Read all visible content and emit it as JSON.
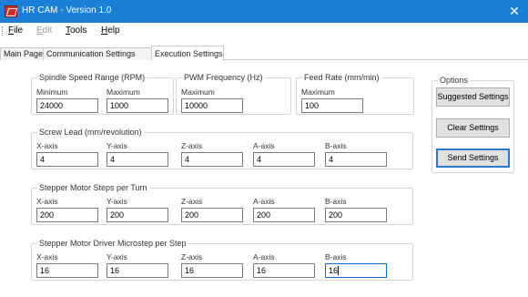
{
  "window": {
    "title": "HR CAM - Version 1.0",
    "close_glyph": "✕"
  },
  "menu": {
    "file": {
      "u": "F",
      "rest": "ile"
    },
    "edit": {
      "u": "E",
      "rest": "dit"
    },
    "tools": {
      "u": "T",
      "rest": "ools"
    },
    "help": {
      "u": "H",
      "rest": "elp"
    }
  },
  "tabs": [
    {
      "label": "Main Page"
    },
    {
      "label": "Communication Settings"
    },
    {
      "label": "Execution Settings"
    }
  ],
  "spindle": {
    "title": "Spindle Speed Range (RPM)",
    "min_label": "Minimum",
    "min_value": "24000",
    "max_label": "Maximum",
    "max_value": "1000"
  },
  "pwm": {
    "title": "PWM Frequency (Hz)",
    "max_label": "Maximum",
    "max_value": "10000"
  },
  "feed": {
    "title": "Feed Rate (mm/min)",
    "max_label": "Maximum",
    "max_value": "100"
  },
  "options": {
    "title": "Options",
    "suggested": "Suggested Settings",
    "clear": "Clear Settings",
    "send": "Send Settings"
  },
  "screw_lead": {
    "title": "Screw Lead (mm/revolution)",
    "axes": [
      "X-axis",
      "Y-axis",
      "Z-axis",
      "A-axis",
      "B-axis"
    ],
    "values": [
      "4",
      "4",
      "4",
      "4",
      "4"
    ]
  },
  "steps_per_turn": {
    "title": "Stepper Motor Steps per Turn",
    "axes": [
      "X-axis",
      "Y-axis",
      "Z-axis",
      "A-axis",
      "B-axis"
    ],
    "values": [
      "200",
      "200",
      "200",
      "200",
      "200"
    ]
  },
  "microstep": {
    "title": "Stepper Motor Driver Microstep per Step",
    "axes": [
      "X-axis",
      "Y-axis",
      "Z-axis",
      "A-axis",
      "B-axis"
    ],
    "values": [
      "16",
      "16",
      "16",
      "16",
      "16"
    ]
  },
  "colors": {
    "titlebar": "#1a7fd6",
    "focus_border": "#0a6ed1"
  }
}
